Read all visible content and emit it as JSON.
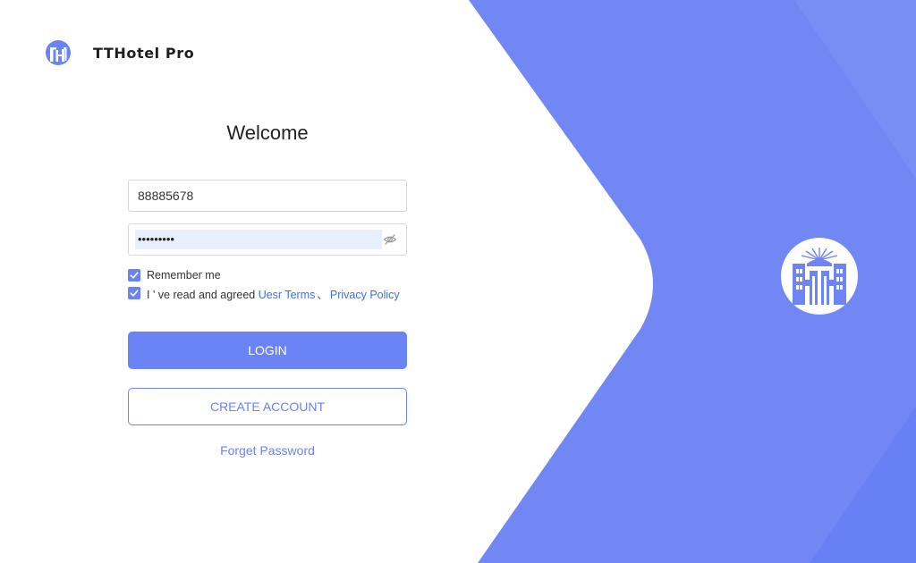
{
  "app": {
    "name": "TTHotel Pro",
    "logo_icon": "building-logo-icon",
    "hero_icon": "building-logo-icon"
  },
  "colors": {
    "accent": "#6a83f5",
    "panel": "#6d84f4",
    "panel_light": "#7c90f5",
    "link": "#3d6fe0"
  },
  "login": {
    "title": "Welcome",
    "phone_value": "88885678",
    "password_mask": "•••••••••",
    "password_icon": "eye-slash-icon",
    "remember_label": "Remember me",
    "remember_checked": true,
    "agree_prefix": "I ' ve read and agreed ",
    "agree_checked": true,
    "terms_link": "Uesr Terms",
    "separator": "、",
    "privacy_link": "Privacy Policy",
    "login_button": "LOGIN",
    "create_button": "CREATE ACCOUNT",
    "forgot_link": "Forget Password"
  }
}
